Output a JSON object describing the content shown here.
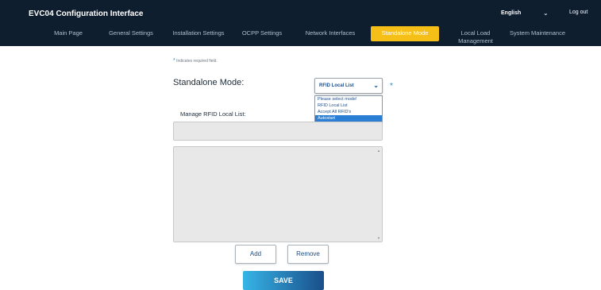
{
  "header": {
    "title": "EVC04 Configuration Interface",
    "language": "English",
    "logout_label": "Log out"
  },
  "nav": {
    "tabs": [
      {
        "label": "Main Page"
      },
      {
        "label": "General Settings"
      },
      {
        "label": "Installation Settings"
      },
      {
        "label": "OCPP Settings"
      },
      {
        "label": "Network Interfaces"
      },
      {
        "label": "Standalone Mode",
        "active": true
      },
      {
        "label": "Local Load Management"
      },
      {
        "label": "System Maintenance"
      }
    ]
  },
  "form": {
    "required_note": "Indicates required field.",
    "required_marker": "*",
    "mode_label": "Standalone Mode:",
    "mode_value": "RFID Local List",
    "mode_options": [
      "Please select mode!",
      "RFID Local List",
      "Accept All RFID's",
      "Autostart"
    ],
    "highlighted_option": "Autostart",
    "rfid_list_label": "Manage RFID Local List:",
    "rfid_input_value": "",
    "rfid_list_value": "",
    "add_label": "Add",
    "remove_label": "Remove",
    "save_label": "SAVE"
  },
  "colors": {
    "navbar": "#0f1e2e",
    "active_tab": "#f6bf18",
    "accent_blue": "#1c8fd0",
    "save_gradient_start": "#36b5e6",
    "save_gradient_end": "#1a4e8a"
  },
  "icons": {
    "language_dropdown": "chevron-down-icon",
    "select_dropdown": "chevron-down-icon",
    "textarea_scroll": [
      "scroll-up-icon",
      "scroll-down-icon"
    ]
  }
}
